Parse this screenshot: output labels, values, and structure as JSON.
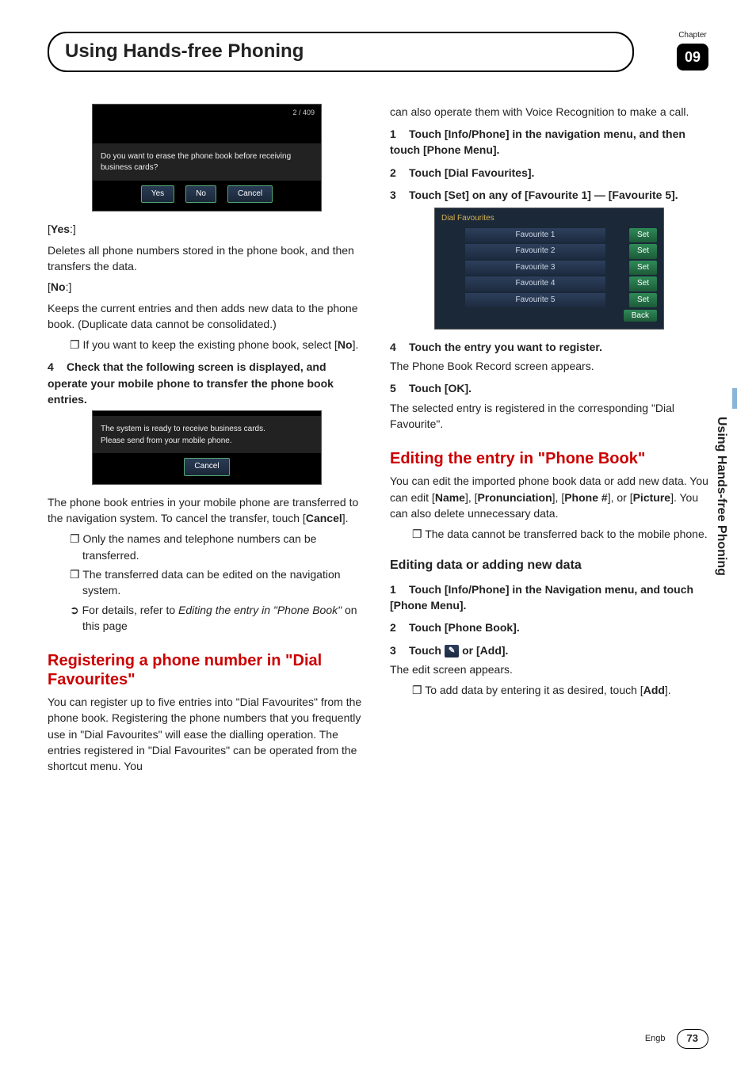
{
  "header": {
    "chapter_label": "Chapter",
    "chapter_num": "09",
    "title": "Using Hands-free Phoning"
  },
  "sidetab": "Using Hands-free Phoning",
  "footer": {
    "lang": "Engb",
    "page": "73"
  },
  "left": {
    "shot1": {
      "counter": "2 / 409",
      "msg": "Do you want to erase the phone book before receiving business cards?",
      "yes": "Yes",
      "no": "No",
      "cancel": "Cancel"
    },
    "yes_label": "Yes",
    "yes_colon": ":",
    "yes_desc": "Deletes all phone numbers stored in the phone book, and then transfers the data.",
    "no_label": "No",
    "no_colon": ":",
    "no_desc": "Keeps the current entries and then adds new data to the phone book. (Duplicate data cannot be consolidated.)",
    "no_bullet": "If you want to keep the existing phone book, select [",
    "no_bullet_bold": "No",
    "no_bullet_end": "].",
    "step4": {
      "num": "4",
      "text": "Check that the following screen is displayed, and operate your mobile phone to transfer the phone book entries."
    },
    "shot2": {
      "line1": "The system is ready to receive business cards.",
      "line2": "Please send from your mobile phone.",
      "cancel": "Cancel"
    },
    "p_after_shot2": "The phone book entries in your mobile phone are transferred to the navigation system. To cancel the transfer, touch [",
    "p_after_shot2_bold": "Cancel",
    "p_after_shot2_end": "].",
    "b1": "Only the names and telephone numbers can be transferred.",
    "b2": "The transferred data can be edited on the navigation system.",
    "b2_arrow_pre": "For details, refer to ",
    "b2_arrow_italic": "Editing the entry in \"Phone Book\"",
    "b2_arrow_post": " on this page",
    "h2_reg": "Registering a phone number in \"Dial Favourites\"",
    "p_reg": "You can register up to five entries into \"Dial Favourites\" from the phone book. Registering the phone numbers that you frequently use in \"Dial Favourites\" will ease the dialling operation. The entries registered in \"Dial Favourites\" can be operated from the shortcut menu. You"
  },
  "right": {
    "p_cont": "can also operate them with Voice Recognition to make a call.",
    "s1": {
      "n": "1",
      "t": "Touch [Info/Phone] in the navigation menu, and then touch [Phone Menu]."
    },
    "s2": {
      "n": "2",
      "t": "Touch [Dial Favourites]."
    },
    "s3": {
      "n": "3",
      "t": "Touch [Set] on any of [Favourite 1] — [Favourite 5]."
    },
    "shot3": {
      "title": "Dial Favourites",
      "rows": [
        "Favourite 1",
        "Favourite 2",
        "Favourite 3",
        "Favourite 4",
        "Favourite 5"
      ],
      "set": "Set",
      "back": "Back"
    },
    "s4": {
      "n": "4",
      "t": "Touch the entry you want to register."
    },
    "s4_after": "The Phone Book Record screen appears.",
    "s5": {
      "n": "5",
      "t": "Touch [OK]."
    },
    "s5_after": "The selected entry is registered in the corresponding \"Dial Favourite\".",
    "h2_edit": "Editing the entry in \"Phone Book\"",
    "p_edit1a": "You can edit the imported phone book data or add new data. You can edit [",
    "name": "Name",
    "p_edit1b": "], [",
    "pronun": "Pronunciation",
    "p_edit1c": "], [",
    "phone": "Phone #",
    "p_edit1d": "], or [",
    "picture": "Picture",
    "p_edit1e": "]. You can also delete unnecessary data.",
    "b_edit": "The data cannot be transferred back to the mobile phone.",
    "h3_edit": "Editing data or adding new data",
    "e1": {
      "n": "1",
      "t": "Touch [Info/Phone] in the Navigation menu, and touch [Phone Menu]."
    },
    "e2": {
      "n": "2",
      "t": "Touch [Phone Book]."
    },
    "e3_n": "3",
    "e3_pre": "Touch ",
    "e3_icon": "✎",
    "e3_post": " or [Add].",
    "e3_after": "The edit screen appears.",
    "e3_b_pre": "To add data by entering it as desired, touch [",
    "e3_b_bold": "Add",
    "e3_b_post": "]."
  }
}
